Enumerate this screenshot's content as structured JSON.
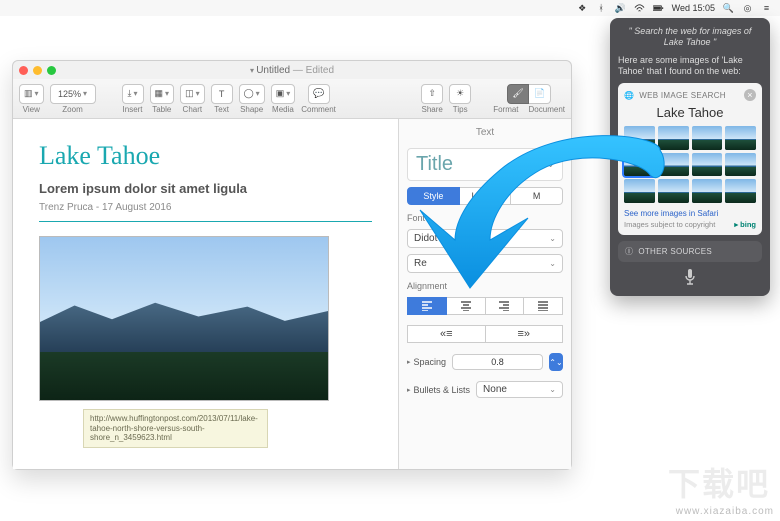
{
  "menubar": {
    "time": "Wed 15:05"
  },
  "window": {
    "title": "Untitled",
    "status": "Edited",
    "toolbar": {
      "view": "View",
      "zoom": "Zoom",
      "zoom_value": "125%",
      "insert": "Insert",
      "table": "Table",
      "chart": "Chart",
      "text": "Text",
      "shape": "Shape",
      "media": "Media",
      "comment": "Comment",
      "share": "Share",
      "tips": "Tips",
      "format": "Format",
      "document": "Document"
    }
  },
  "document": {
    "h1": "Lake Tahoe",
    "h2": "Lorem ipsum dolor sit amet ligula",
    "byline": "Trenz Pruca - 17 August 2016",
    "url_tooltip": "http://www.huffingtonpost.com/2013/07/11/lake-tahoe-north-shore-versus-south-shore_n_3459623.html"
  },
  "inspector": {
    "tab": "Text",
    "para_style": "Title",
    "segments": {
      "style": "Style",
      "layout": "Layout",
      "more": "M"
    },
    "font_label": "Font",
    "font_value": "Didot",
    "alignment_label": "Alignment",
    "spacing_label": "Spacing",
    "spacing_value": "0.8",
    "bullets_label": "Bullets & Lists",
    "bullets_value": "None"
  },
  "siri": {
    "query": "\" Search the web for images of Lake Tahoe \"",
    "response": "Here are some images of 'Lake Tahoe' that I found on the web:",
    "card_header": "WEB IMAGE SEARCH",
    "card_title": "Lake Tahoe",
    "more": "See more images in Safari",
    "copyright": "Images subject to copyright",
    "provider": "bing",
    "other": "OTHER SOURCES"
  },
  "watermark": {
    "url": "www.xiazaiba.com",
    "cn": "下载吧"
  }
}
